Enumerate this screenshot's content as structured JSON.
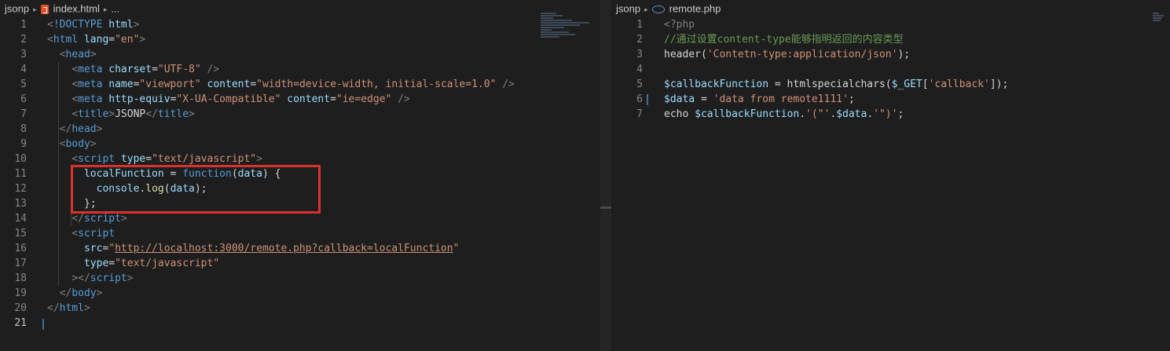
{
  "left": {
    "breadcrumb": {
      "folder": "jsonp",
      "file": "index.html",
      "more": "..."
    },
    "lines": [
      [
        [
          "p",
          "<"
        ],
        [
          "t",
          "!DOCTYPE"
        ],
        [
          "w",
          " "
        ],
        [
          "a",
          "html"
        ],
        [
          "p",
          ">"
        ]
      ],
      [
        [
          "p",
          "<"
        ],
        [
          "t",
          "html"
        ],
        [
          "w",
          " "
        ],
        [
          "a",
          "lang"
        ],
        [
          "w",
          "="
        ],
        [
          "s",
          "\"en\""
        ],
        [
          "p",
          ">"
        ]
      ],
      [
        [
          "w",
          "  "
        ],
        [
          "p",
          "<"
        ],
        [
          "t",
          "head"
        ],
        [
          "p",
          ">"
        ]
      ],
      [
        [
          "w",
          "    "
        ],
        [
          "p",
          "<"
        ],
        [
          "t",
          "meta"
        ],
        [
          "w",
          " "
        ],
        [
          "a",
          "charset"
        ],
        [
          "w",
          "="
        ],
        [
          "s",
          "\"UTF-8\""
        ],
        [
          "w",
          " "
        ],
        [
          "p",
          "/>"
        ]
      ],
      [
        [
          "w",
          "    "
        ],
        [
          "p",
          "<"
        ],
        [
          "t",
          "meta"
        ],
        [
          "w",
          " "
        ],
        [
          "a",
          "name"
        ],
        [
          "w",
          "="
        ],
        [
          "s",
          "\"viewport\""
        ],
        [
          "w",
          " "
        ],
        [
          "a",
          "content"
        ],
        [
          "w",
          "="
        ],
        [
          "s",
          "\"width=device-width, initial-scale=1.0\""
        ],
        [
          "w",
          " "
        ],
        [
          "p",
          "/>"
        ]
      ],
      [
        [
          "w",
          "    "
        ],
        [
          "p",
          "<"
        ],
        [
          "t",
          "meta"
        ],
        [
          "w",
          " "
        ],
        [
          "a",
          "http-equiv"
        ],
        [
          "w",
          "="
        ],
        [
          "s",
          "\"X-UA-Compatible\""
        ],
        [
          "w",
          " "
        ],
        [
          "a",
          "content"
        ],
        [
          "w",
          "="
        ],
        [
          "s",
          "\"ie=edge\""
        ],
        [
          "w",
          " "
        ],
        [
          "p",
          "/>"
        ]
      ],
      [
        [
          "w",
          "    "
        ],
        [
          "p",
          "<"
        ],
        [
          "t",
          "title"
        ],
        [
          "p",
          ">"
        ],
        [
          "w",
          "JSONP"
        ],
        [
          "p",
          "</"
        ],
        [
          "t",
          "title"
        ],
        [
          "p",
          ">"
        ]
      ],
      [
        [
          "w",
          "  "
        ],
        [
          "p",
          "</"
        ],
        [
          "t",
          "head"
        ],
        [
          "p",
          ">"
        ]
      ],
      [
        [
          "w",
          "  "
        ],
        [
          "p",
          "<"
        ],
        [
          "t",
          "body"
        ],
        [
          "p",
          ">"
        ]
      ],
      [
        [
          "w",
          "    "
        ],
        [
          "p",
          "<"
        ],
        [
          "t",
          "script"
        ],
        [
          "w",
          " "
        ],
        [
          "a",
          "type"
        ],
        [
          "w",
          "="
        ],
        [
          "s",
          "\"text/javascript\""
        ],
        [
          "p",
          ">"
        ]
      ],
      [
        [
          "w",
          "      "
        ],
        [
          "v",
          "localFunction"
        ],
        [
          "w",
          " = "
        ],
        [
          "k",
          "function"
        ],
        [
          "w",
          "("
        ],
        [
          "v",
          "data"
        ],
        [
          "w",
          ") {"
        ]
      ],
      [
        [
          "w",
          "        "
        ],
        [
          "v",
          "console"
        ],
        [
          "w",
          "."
        ],
        [
          "y",
          "log"
        ],
        [
          "w",
          "("
        ],
        [
          "v",
          "data"
        ],
        [
          "w",
          ");"
        ]
      ],
      [
        [
          "w",
          "      };"
        ]
      ],
      [
        [
          "w",
          "    "
        ],
        [
          "p",
          "</"
        ],
        [
          "t",
          "script"
        ],
        [
          "p",
          ">"
        ]
      ],
      [
        [
          "w",
          "    "
        ],
        [
          "p",
          "<"
        ],
        [
          "t",
          "script"
        ]
      ],
      [
        [
          "w",
          "      "
        ],
        [
          "a",
          "src"
        ],
        [
          "w",
          "="
        ],
        [
          "s",
          "\""
        ],
        [
          "u",
          "http://localhost:3000/remote.php?callback=localFunction"
        ],
        [
          "s",
          "\""
        ]
      ],
      [
        [
          "w",
          "      "
        ],
        [
          "a",
          "type"
        ],
        [
          "w",
          "="
        ],
        [
          "s",
          "\"text/javascript\""
        ]
      ],
      [
        [
          "w",
          "    "
        ],
        [
          "p",
          "></"
        ],
        [
          "t",
          "script"
        ],
        [
          "p",
          ">"
        ]
      ],
      [
        [
          "w",
          "  "
        ],
        [
          "p",
          "</"
        ],
        [
          "t",
          "body"
        ],
        [
          "p",
          ">"
        ]
      ],
      [
        [
          "p",
          "</"
        ],
        [
          "t",
          "html"
        ],
        [
          "p",
          ">"
        ]
      ],
      []
    ],
    "active_line": 21
  },
  "right": {
    "breadcrumb": {
      "folder": "jsonp",
      "file": "remote.php"
    },
    "lines": [
      [
        [
          "p",
          "<?php"
        ]
      ],
      [
        [
          "c",
          "//通过设置content-type能够指明返回的内容类型"
        ]
      ],
      [
        [
          "w",
          "header("
        ],
        [
          "s",
          "'Contetn-type:application/json'"
        ],
        [
          "w",
          ");"
        ]
      ],
      [],
      [
        [
          "v",
          "$callbackFunction"
        ],
        [
          "w",
          " = htmlspecialchars("
        ],
        [
          "v",
          "$_GET"
        ],
        [
          "w",
          "["
        ],
        [
          "s",
          "'callback'"
        ],
        [
          "w",
          "]);"
        ]
      ],
      [
        [
          "v",
          "$data"
        ],
        [
          "w",
          " = "
        ],
        [
          "s",
          "'data from remote1111'"
        ],
        [
          "w",
          ";"
        ]
      ],
      [
        [
          "w",
          "echo "
        ],
        [
          "v",
          "$callbackFunction"
        ],
        [
          "w",
          "."
        ],
        [
          "s",
          "'(\"'"
        ],
        [
          "w",
          "."
        ],
        [
          "v",
          "$data"
        ],
        [
          "w",
          "."
        ],
        [
          "s",
          "'\")'"
        ],
        [
          "w",
          ";"
        ]
      ]
    ]
  }
}
